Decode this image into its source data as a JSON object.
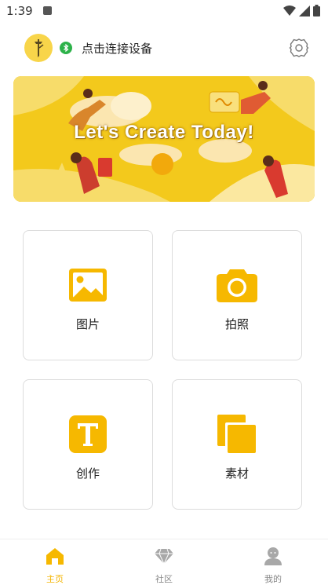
{
  "status_bar": {
    "time": "1:39"
  },
  "header": {
    "connect_label": "点击连接设备"
  },
  "banner": {
    "title": "Let's Create Today!"
  },
  "features": [
    {
      "label": "图片",
      "icon": "image-icon"
    },
    {
      "label": "拍照",
      "icon": "camera-icon"
    },
    {
      "label": "创作",
      "icon": "text-icon"
    },
    {
      "label": "素材",
      "icon": "copy-icon"
    }
  ],
  "tabs": [
    {
      "label": "主页",
      "icon": "home-icon",
      "active": true
    },
    {
      "label": "社区",
      "icon": "diamond-icon",
      "active": false
    },
    {
      "label": "我的",
      "icon": "person-icon",
      "active": false
    }
  ],
  "colors": {
    "accent": "#F6B800",
    "bluetooth": "#2DB24A",
    "banner": "#F3C91C",
    "inactive": "#999999"
  }
}
